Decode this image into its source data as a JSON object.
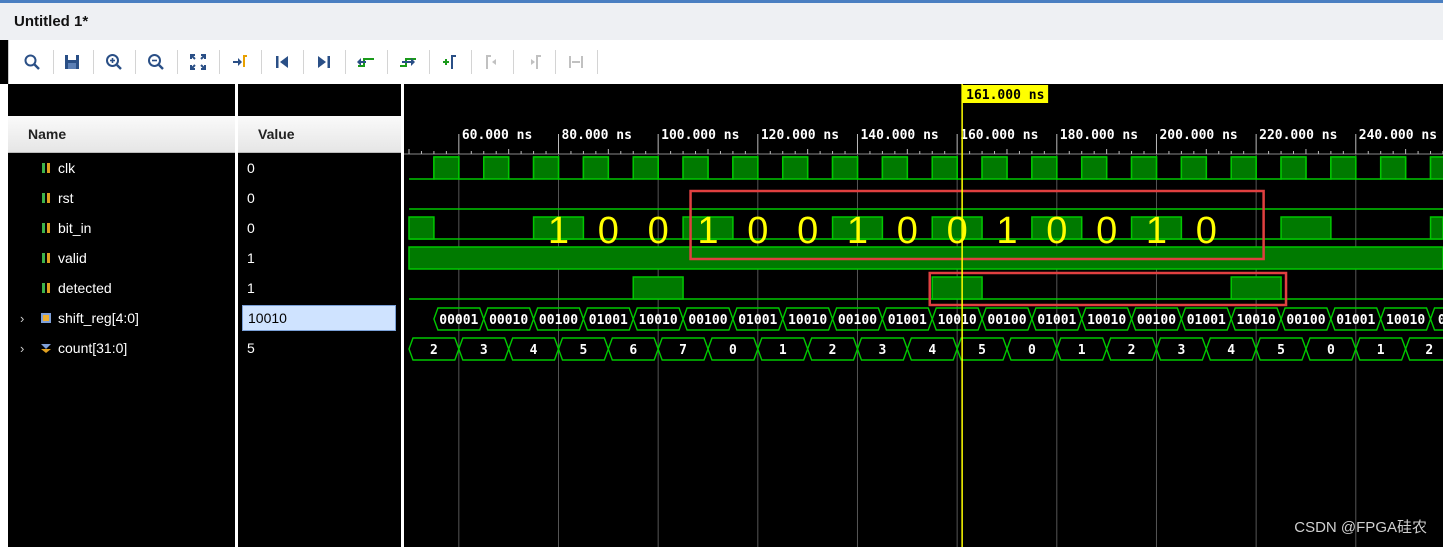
{
  "window": {
    "title": "Untitled 1*"
  },
  "toolbar": {
    "icons": [
      "search-icon",
      "save-icon",
      "zoom-in-icon",
      "zoom-out-icon",
      "zoom-fit-icon",
      "go-to-cursor-icon",
      "go-to-time-0-icon",
      "go-to-last-time-icon",
      "previous-transition-icon",
      "next-transition-icon",
      "add-marker-icon",
      "previous-marker-icon",
      "next-marker-icon",
      "swap-cursors-icon"
    ]
  },
  "columns": {
    "name_header": "Name",
    "value_header": "Value"
  },
  "signals": [
    {
      "name": "clk",
      "value": "0",
      "icon": "single-bit-icon",
      "expandable": false
    },
    {
      "name": "rst",
      "value": "0",
      "icon": "single-bit-icon",
      "expandable": false
    },
    {
      "name": "bit_in",
      "value": "0",
      "icon": "single-bit-icon",
      "expandable": false
    },
    {
      "name": "valid",
      "value": "1",
      "icon": "single-bit-icon",
      "expandable": false
    },
    {
      "name": "detected",
      "value": "1",
      "icon": "single-bit-icon",
      "expandable": false
    },
    {
      "name": "shift_reg[4:0]",
      "value": "10010",
      "icon": "bus-icon",
      "expandable": true,
      "selected": true
    },
    {
      "name": "count[31:0]",
      "value": "5",
      "icon": "integer-bus-icon",
      "expandable": true
    }
  ],
  "timeline": {
    "cursor_label": "161.000 ns",
    "cursor_time_ns": 161,
    "view_start_ns": 50,
    "view_end_ns": 257.5,
    "tick_labels": [
      "60.000 ns",
      "80.000 ns",
      "100.000 ns",
      "120.000 ns",
      "140.000 ns",
      "160.000 ns",
      "180.000 ns",
      "200.000 ns",
      "220.000 ns",
      "240.000 ns"
    ],
    "tick_times_ns": [
      60,
      80,
      100,
      120,
      140,
      160,
      180,
      200,
      220,
      240
    ]
  },
  "waves": {
    "clk_period_ns": 10,
    "bit_in_high_intervals_ns": [
      [
        50,
        55
      ],
      [
        75,
        85
      ],
      [
        105,
        115
      ],
      [
        135,
        145
      ],
      [
        155,
        165
      ],
      [
        175,
        185
      ],
      [
        195,
        205
      ],
      [
        225,
        235
      ],
      [
        255,
        260
      ]
    ],
    "detected_high_intervals_ns": [
      [
        95,
        105
      ],
      [
        155,
        165
      ],
      [
        215,
        225
      ]
    ],
    "shift_reg_values": [
      "00001",
      "00010",
      "00100",
      "01001",
      "10010",
      "00100",
      "01001",
      "10010",
      "00100",
      "01001",
      "10010",
      "00100",
      "01001",
      "10010",
      "00100",
      "01001",
      "10010",
      "00100",
      "01001",
      "10010",
      "0"
    ],
    "shift_reg_start_ns": 55,
    "count_values": [
      "2",
      "3",
      "4",
      "5",
      "6",
      "7",
      "0",
      "1",
      "2",
      "3",
      "4",
      "5",
      "0",
      "1",
      "2",
      "3",
      "4",
      "5",
      "0",
      "1",
      "2"
    ],
    "count_start_ns": 50
  },
  "annotations": {
    "bit_labels": [
      "1",
      "0",
      "0",
      "1",
      "0",
      "0",
      "1",
      "0",
      "0",
      "1",
      "0",
      "0",
      "1",
      "0",
      "0",
      "1",
      "0"
    ],
    "bit_label_times_ns": [
      80,
      90,
      100,
      110,
      120,
      130,
      140,
      150,
      160,
      170,
      180,
      190,
      200,
      210
    ],
    "box_color": "#e04040"
  },
  "colors": {
    "wave": "#00c800",
    "wave_fill": "#007a00",
    "cursor": "#ffff00",
    "label_bg": "#ffff00",
    "grid": "#555555",
    "highlight_value": "#cfe3ff"
  },
  "watermark": "CSDN @FPGA硅农"
}
